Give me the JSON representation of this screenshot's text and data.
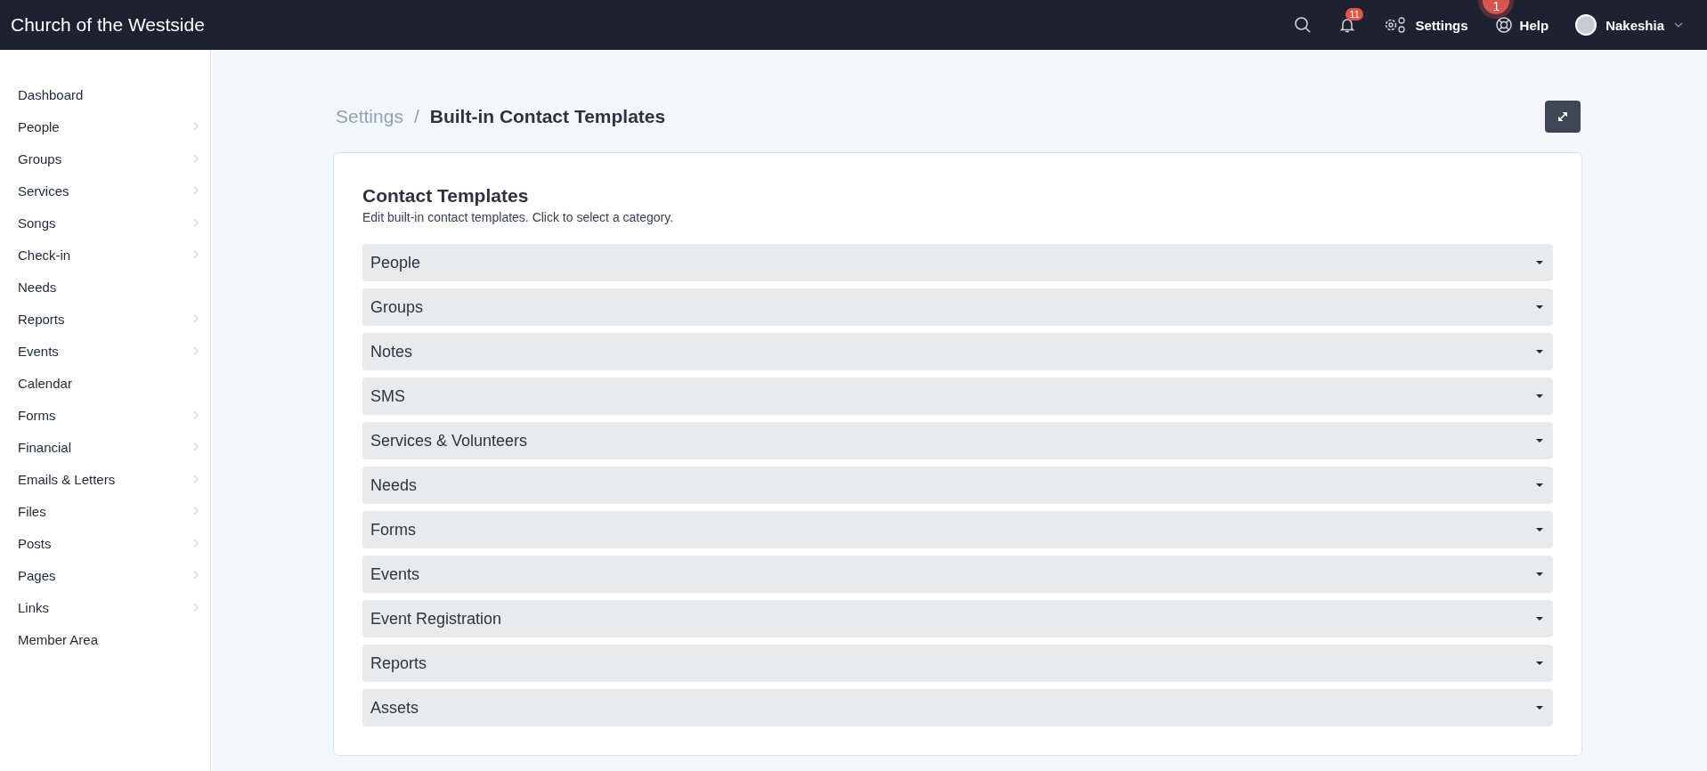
{
  "navbar": {
    "brand": "Church of the Westside",
    "notifications_badge": "11",
    "settings_label": "Settings",
    "floating_badge": "1",
    "help_label": "Help",
    "user_name": "Nakeshia"
  },
  "sidebar": {
    "items": [
      {
        "label": "Dashboard",
        "has_children": false
      },
      {
        "label": "People",
        "has_children": true
      },
      {
        "label": "Groups",
        "has_children": true
      },
      {
        "label": "Services",
        "has_children": true
      },
      {
        "label": "Songs",
        "has_children": true
      },
      {
        "label": "Check-in",
        "has_children": true
      },
      {
        "label": "Needs",
        "has_children": false
      },
      {
        "label": "Reports",
        "has_children": true
      },
      {
        "label": "Events",
        "has_children": true
      },
      {
        "label": "Calendar",
        "has_children": false
      },
      {
        "label": "Forms",
        "has_children": true
      },
      {
        "label": "Financial",
        "has_children": true
      },
      {
        "label": "Emails & Letters",
        "has_children": true
      },
      {
        "label": "Files",
        "has_children": true
      },
      {
        "label": "Posts",
        "has_children": true
      },
      {
        "label": "Pages",
        "has_children": true
      },
      {
        "label": "Links",
        "has_children": true
      },
      {
        "label": "Member Area",
        "has_children": false
      }
    ]
  },
  "breadcrumb": {
    "parent": "Settings",
    "separator": "/",
    "current": "Built-in Contact Templates"
  },
  "card": {
    "title": "Contact Templates",
    "description": "Edit built-in contact templates. Click to select a category.",
    "categories": [
      {
        "label": "People",
        "expanded": false
      },
      {
        "label": "Groups",
        "expanded": false
      },
      {
        "label": "Notes",
        "expanded": false
      },
      {
        "label": "SMS",
        "expanded": false
      },
      {
        "label": "Services & Volunteers",
        "expanded": false
      },
      {
        "label": "Needs",
        "expanded": false
      },
      {
        "label": "Forms",
        "expanded": false
      },
      {
        "label": "Events",
        "expanded": false
      },
      {
        "label": "Event Registration",
        "expanded": false
      },
      {
        "label": "Reports",
        "expanded": false
      },
      {
        "label": "Assets",
        "expanded": false
      }
    ]
  }
}
